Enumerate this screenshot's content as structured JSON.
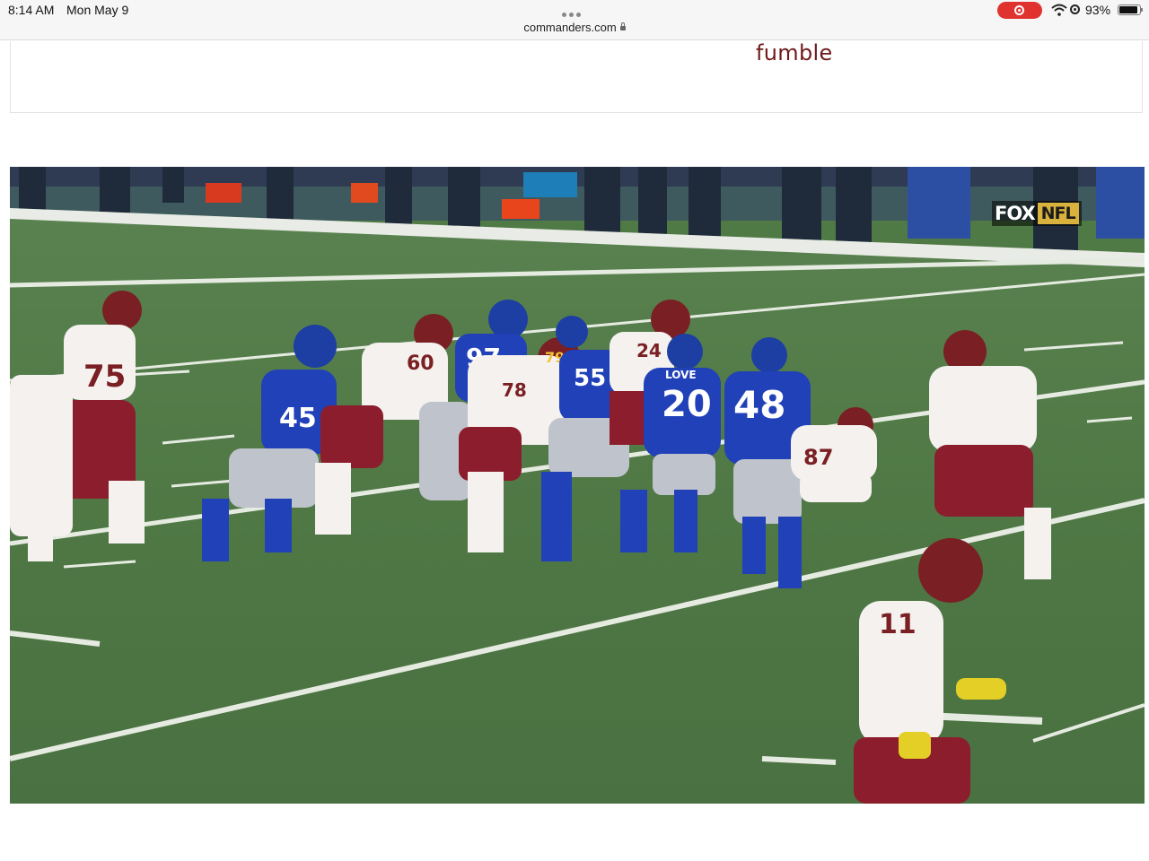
{
  "status_bar": {
    "time": "8:14 AM",
    "date": "Mon May 9",
    "url": "commanders.com",
    "battery_percent": "93%",
    "battery_level": 0.93,
    "icons": [
      "more-dots-icon",
      "lock-icon",
      "screen-record-icon",
      "wifi-icon",
      "orientation-lock-icon",
      "battery-icon"
    ],
    "record_color": "#e0332f"
  },
  "article": {
    "caption_link": "fumble",
    "caption_link_color": "#6f1a1a"
  },
  "video": {
    "network_bug": {
      "network": "FOX",
      "league": "NFL"
    },
    "jersey_numbers": [
      "75",
      "45",
      "60",
      "97",
      "78",
      "79",
      "55",
      "24",
      "20",
      "48",
      "87",
      "11"
    ],
    "colors": {
      "home_jersey": "#ffffff",
      "home_helmet": "#7a1f23",
      "home_pants": "#8b1d2c",
      "away_jersey": "#2141b8",
      "away_pants": "#bfc3cb",
      "field": "#4f7a45"
    }
  }
}
